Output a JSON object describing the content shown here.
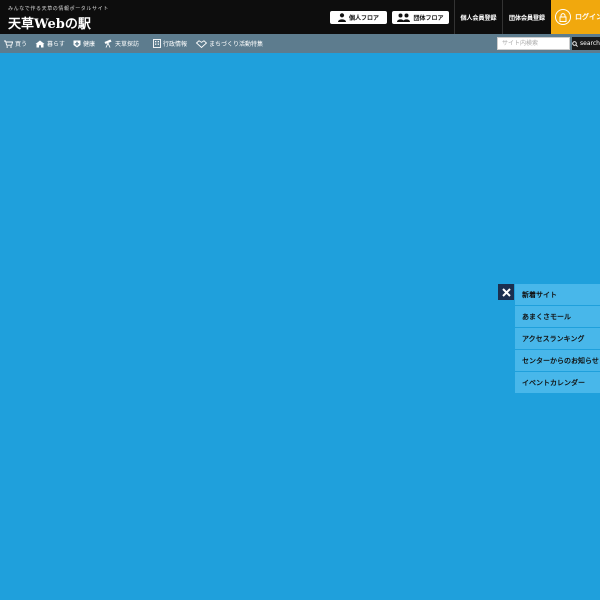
{
  "header": {
    "tagline": "みんなで作る天草の情報ポータルサイト",
    "site_title": "天草Webの駅",
    "floor_buttons": [
      {
        "label": "個人フロア",
        "icon": "person-icon"
      },
      {
        "label": "団体フロア",
        "icon": "group-icon"
      }
    ],
    "registration_links": [
      {
        "label": "個人会員登録"
      },
      {
        "label": "団体会員登録"
      }
    ],
    "login": {
      "label": "ログイン",
      "icon": "lock-icon"
    }
  },
  "nav": {
    "items": [
      {
        "label": "買う",
        "icon": "cart-icon"
      },
      {
        "label": "暮らす",
        "icon": "house-icon"
      },
      {
        "label": "健康",
        "icon": "health-cross-icon"
      },
      {
        "label": "天草探訪",
        "icon": "telescope-icon"
      },
      {
        "label": "行政情報",
        "icon": "building-icon"
      },
      {
        "label": "まちづくり活動特集",
        "icon": "handshake-icon"
      }
    ],
    "search": {
      "placeholder": "サイト内検索",
      "button_label": "search"
    }
  },
  "side_panel": {
    "items": [
      {
        "label": "新着サイト"
      },
      {
        "label": "あまくさモール"
      },
      {
        "label": "アクセスランキング"
      },
      {
        "label": "センターからのお知らせ"
      },
      {
        "label": "イベントカレンダー"
      }
    ]
  },
  "colors": {
    "page_background": "#1fa0dc",
    "header_background": "#0d0d0d",
    "nav_background": "#5d7c8e",
    "login_accent": "#f1a80d",
    "side_item": "#48b7ea",
    "close_button": "#1b2f4f"
  }
}
